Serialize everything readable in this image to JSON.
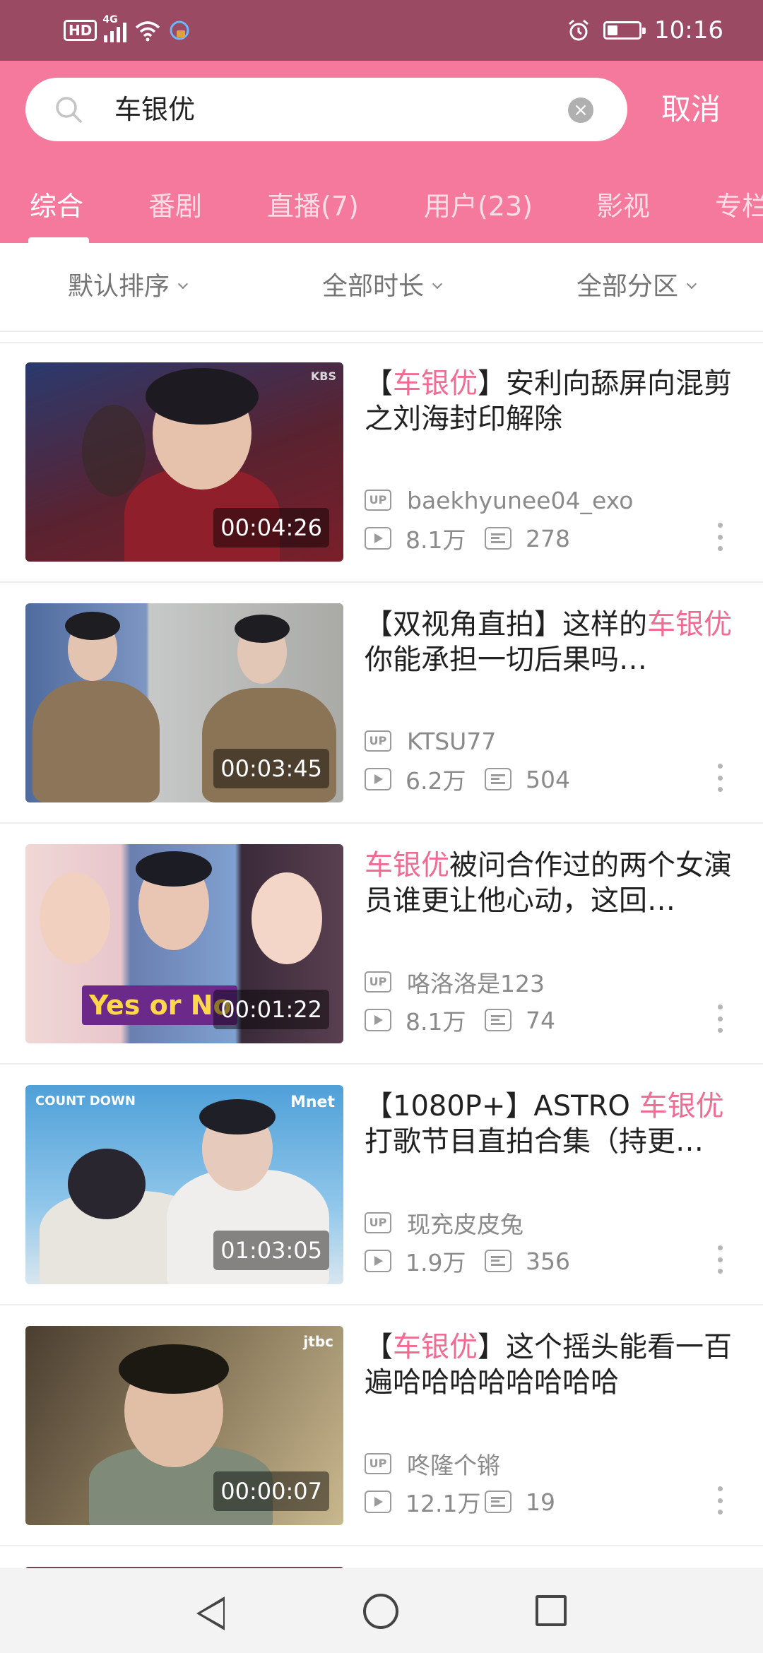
{
  "status_bar": {
    "hd": "HD",
    "network": "4G",
    "time": "10:16",
    "battery_level": 0.3
  },
  "search": {
    "query": "车银优",
    "cancel_label": "取消"
  },
  "tabs": [
    {
      "label": "综合",
      "active": true
    },
    {
      "label": "番剧",
      "active": false
    },
    {
      "label": "直播(7)",
      "active": false
    },
    {
      "label": "用户(23)",
      "active": false
    },
    {
      "label": "影视",
      "active": false
    },
    {
      "label": "专栏",
      "active": false
    }
  ],
  "filters": {
    "sort": "默认排序",
    "duration": "全部时长",
    "zone": "全部分区"
  },
  "videos": [
    {
      "title_pre": "【",
      "title_hl": "车银优",
      "title_post": "】安利向舔屏向混剪之刘海封印解除",
      "duration": "00:04:26",
      "uploader": "baekhyunee04_exo",
      "views": "8.1万",
      "danmaku": "278",
      "thumb_logo": "KBS"
    },
    {
      "title_pre": "【双视角直拍】这样的",
      "title_hl": "车银优",
      "title_post": "你能承担一切后果吗…",
      "duration": "00:03:45",
      "uploader": "KTSU77",
      "views": "6.2万",
      "danmaku": "504",
      "thumb_logo": ""
    },
    {
      "title_pre": "",
      "title_hl": "车银优",
      "title_post": "被问合作过的两个女演员谁更让他心动，这回…",
      "duration": "00:01:22",
      "uploader": "咯洛洛是123",
      "views": "8.1万",
      "danmaku": "74",
      "thumb_logo": "Yes or No"
    },
    {
      "title_pre": "【1080P+】ASTRO ",
      "title_hl": "车银优",
      "title_post": "打歌节目直拍合集（持更…",
      "duration": "01:03:05",
      "uploader": "现充皮皮兔",
      "views": "1.9万",
      "danmaku": "356",
      "thumb_logo": "Mnet"
    },
    {
      "title_pre": "【",
      "title_hl": "车银优",
      "title_post": "】这个摇头能看一百遍哈哈哈哈哈哈哈哈",
      "duration": "00:00:07",
      "uploader": "咚隆个锵",
      "views": "12.1万",
      "danmaku": "19",
      "thumb_logo": "jtbc"
    }
  ],
  "labels": {
    "up_badge": "UP"
  },
  "colors": {
    "brand_pink": "#f4799d",
    "highlight_pink": "#f06c93",
    "status_bar": "#9b4a64"
  }
}
